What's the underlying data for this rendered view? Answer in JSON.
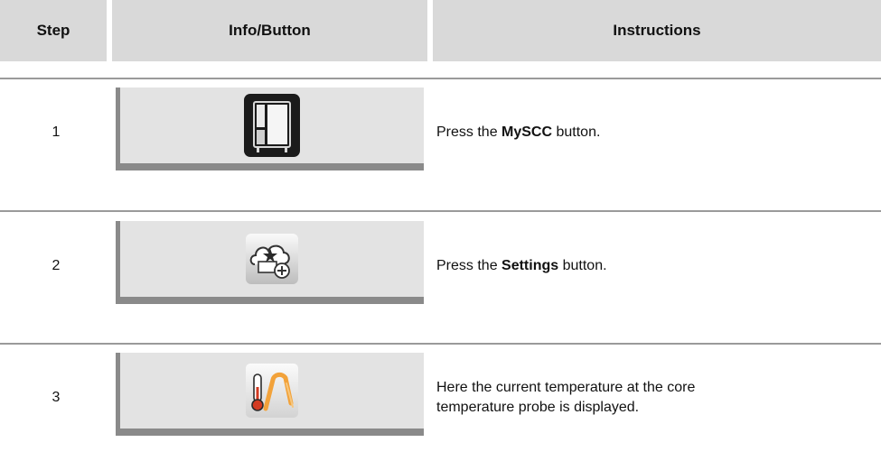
{
  "header": {
    "step": "Step",
    "info_button": "Info/Button",
    "instructions": "Instructions"
  },
  "rows": [
    {
      "step": "1",
      "icon": "myscc-oven-icon",
      "instruction_prefix": "Press the ",
      "instruction_bold": "MySCC",
      "instruction_suffix": " button."
    },
    {
      "step": "2",
      "icon": "settings-cloud-star-icon",
      "instruction_prefix": "Press the ",
      "instruction_bold": "Settings",
      "instruction_suffix": " button."
    },
    {
      "step": "3",
      "icon": "core-temperature-probe-icon",
      "instruction_line1": "Here the current temperature at the core",
      "instruction_line2": "temperature probe is displayed."
    }
  ],
  "colors": {
    "header_bg": "#d9d9d9",
    "button_panel_bg": "#e3e3e3",
    "button_panel_border": "#8a8a8a",
    "rule": "#9a9a9a",
    "probe_orange": "#f2a23a",
    "thermometer_red": "#d23a22"
  }
}
